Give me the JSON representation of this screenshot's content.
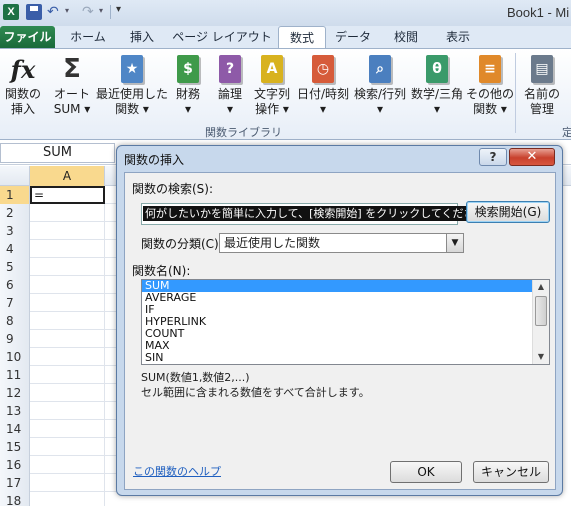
{
  "window": {
    "title": "Book1 - Mi"
  },
  "quick_access": {
    "app_icon_label": "X",
    "more": "▾"
  },
  "ribbon_tabs": [
    "ファイル",
    "ホーム",
    "挿入",
    "ページ レイアウト",
    "数式",
    "データ",
    "校閲",
    "表示"
  ],
  "ribbon_buttons": [
    {
      "line1": "関数の",
      "line2": "挿入",
      "icon": "fx-icon",
      "glyph": "fx"
    },
    {
      "line1": "オート",
      "line2": "SUM ▾",
      "icon": "sigma-icon",
      "glyph": "Σ"
    },
    {
      "line1": "最近使用した",
      "line2": "関数 ▾",
      "icon": "recent-book-icon",
      "glyph": "★",
      "color": "#4f86c6"
    },
    {
      "line1": "財務",
      "line2": "▾",
      "icon": "finance-book-icon",
      "glyph": "$",
      "color": "#3f9a4a"
    },
    {
      "line1": "論理",
      "line2": "▾",
      "icon": "logical-book-icon",
      "glyph": "?",
      "color": "#8e5aa8"
    },
    {
      "line1": "文字列",
      "line2": "操作 ▾",
      "icon": "text-book-icon",
      "glyph": "A",
      "color": "#d8b21f"
    },
    {
      "line1": "日付/時刻",
      "line2": "▾",
      "icon": "datetime-book-icon",
      "glyph": "◷",
      "color": "#d65b3a"
    },
    {
      "line1": "検索/行列",
      "line2": "▾",
      "icon": "lookup-book-icon",
      "glyph": "⌕",
      "color": "#4b7fbf"
    },
    {
      "line1": "数学/三角",
      "line2": "▾",
      "icon": "math-book-icon",
      "glyph": "θ",
      "color": "#3a9a6a"
    },
    {
      "line1": "その他の",
      "line2": "関数 ▾",
      "icon": "more-functions-book-icon",
      "glyph": "≡",
      "color": "#e0892a"
    },
    {
      "line1": "名前の",
      "line2": "管理",
      "icon": "name-manager-icon",
      "glyph": "▤",
      "color": "#6b7a8c"
    }
  ],
  "ribbon_group_label": "関数ライブラリ",
  "ribbon_right_partial": "定",
  "name_box": "SUM",
  "column_header": "A",
  "rows": [
    "1",
    "2",
    "3",
    "4",
    "5",
    "6",
    "7",
    "8",
    "9",
    "10",
    "11",
    "12",
    "13",
    "14",
    "15",
    "16",
    "17",
    "18"
  ],
  "cell_a1": "=",
  "dialog": {
    "title": "関数の挿入",
    "help_button": "?",
    "close_button": "✕",
    "search_label": "関数の検索(S):",
    "search_value": "何がしたいかを簡単に入力して、[検索開始] をクリックしてください。",
    "search_button": "検索開始(G)",
    "category_label": "関数の分類(C):",
    "category_value": "最近使用した関数",
    "function_list_label": "関数名(N):",
    "functions": [
      "SUM",
      "AVERAGE",
      "IF",
      "HYPERLINK",
      "COUNT",
      "MAX",
      "SIN"
    ],
    "syntax": "SUM(数値1,数値2,...)",
    "description": "セル範囲に含まれる数値をすべて合計します。",
    "help_link": "この関数のヘルプ",
    "ok_button": "OK",
    "cancel_button": "キャンセル"
  }
}
